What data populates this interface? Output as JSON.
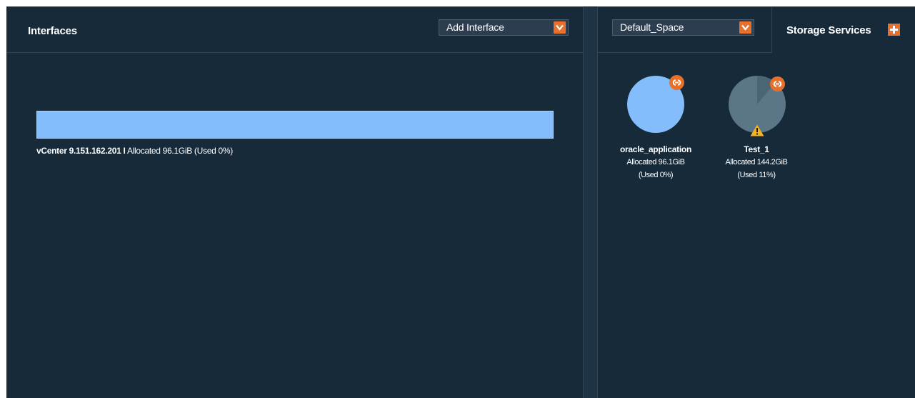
{
  "interfaces_panel": {
    "title": "Interfaces",
    "add_interface_dropdown": {
      "selected": "Add Interface"
    },
    "interface": {
      "name": "vCenter 9.151.162.201",
      "separator": "I",
      "allocation": "Allocated 96.1GiB (Used 0%)",
      "used_fraction": 0,
      "bar_color": "#84bdfc"
    }
  },
  "services_panel": {
    "space_dropdown": {
      "selected": "Default_Space"
    },
    "tab_label": "Storage Services",
    "accent_color": "#e8702a",
    "services": [
      {
        "name": "oracle_application",
        "allocated": "Allocated 96.1GiB",
        "used": "(Used 0%)",
        "used_fraction": 0,
        "pie_color": "#84bdfc",
        "badge_icon": "link-icon",
        "warning": false
      },
      {
        "name": "Test_1",
        "allocated": "Allocated 144.2GiB",
        "used": "(Used 11%)",
        "used_fraction": 0.11,
        "pie_color": "#5b7787",
        "badge_icon": "link-icon",
        "warning": true,
        "warning_icon": "warning-icon"
      }
    ]
  }
}
